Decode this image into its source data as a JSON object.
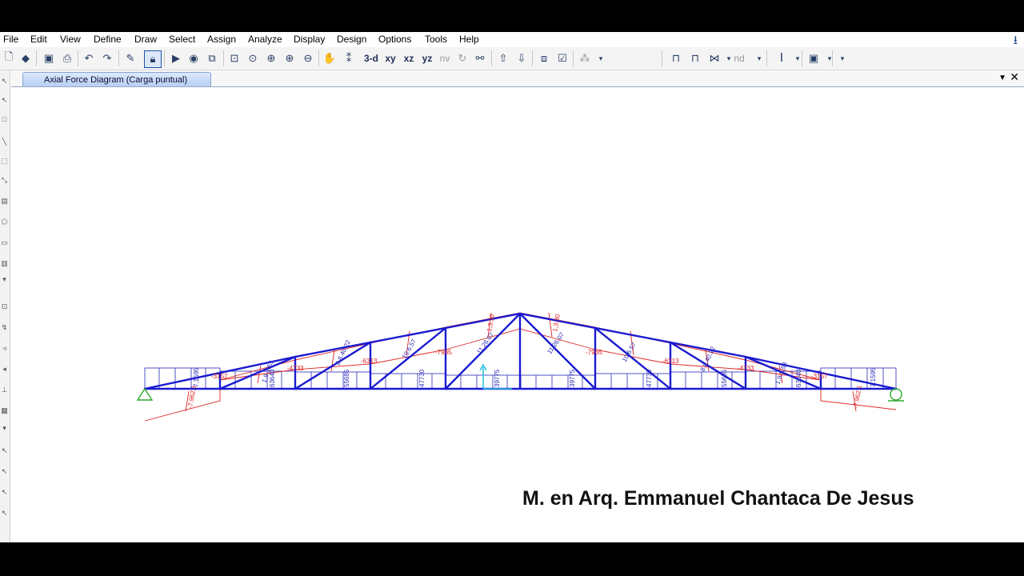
{
  "menu": [
    "File",
    "Edit",
    "View",
    "Define",
    "Draw",
    "Select",
    "Assign",
    "Analyze",
    "Display",
    "Design",
    "Options",
    "Tools",
    "Help"
  ],
  "toolbar": {
    "view_3d": "3-d",
    "view_xy": "xy",
    "view_xz": "xz",
    "view_yz": "yz",
    "view_nv": "nv",
    "view_nd": "nd"
  },
  "tab": {
    "title": "Axial Force Diagram (Carga puntual)"
  },
  "diagram": {
    "top_labels": [
      "-7965.",
      "-7965.",
      "-6313",
      "-6313",
      "-4733",
      "-4733",
      "-3157",
      "-3157",
      "-1575",
      "-1575"
    ],
    "bottom_labels": [
      "7.1595",
      "7.1595",
      "63640",
      "63640",
      "55685",
      "55685",
      "47730",
      "47730",
      "39775",
      "39775"
    ],
    "diagonal_labels": [
      "10.6.57",
      "10.6.57",
      "11.26.07",
      "11.26.07",
      "8.8.40.22",
      "8.8.40.22",
      "1,9.3.53",
      "1,9.3.53",
      "-7.962.1",
      "-7.962.1",
      "1,3.30",
      "1,3.30"
    ]
  },
  "credit": "M. en Arq. Emmanuel Chantaca De Jesus",
  "colors": {
    "truss": "#1a1ad0",
    "compression": "#e02020",
    "tension": "#2a2ab8",
    "support": "#2ea82e",
    "accent": "#1e4fa8"
  },
  "icons": [
    "new-file-icon",
    "open-icon",
    "save-icon",
    "print-icon",
    "undo-icon",
    "redo-icon",
    "pencil-icon",
    "lock-icon",
    "run-icon",
    "run-options-icon",
    "model-check-icon",
    "zoom-window-icon",
    "zoom-fit-icon",
    "zoom-in-icon",
    "zoom-out-icon",
    "zoom-prev-icon",
    "pan-icon",
    "rubber-band-icon",
    "rotate-icon",
    "perspective-icon",
    "move-up-icon",
    "move-down-icon",
    "object-shrink-icon",
    "set-display-icon",
    "assign-icon",
    "frame-icon",
    "frame-double-icon",
    "frame-multi-icon",
    "text-cursor-icon",
    "section-icon"
  ]
}
